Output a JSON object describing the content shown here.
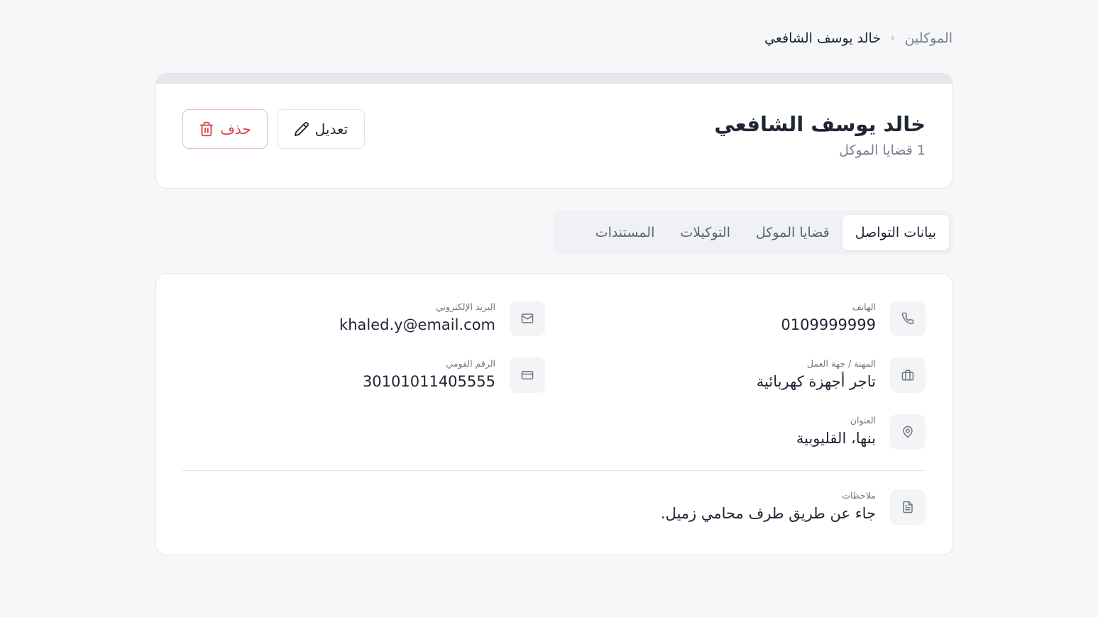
{
  "breadcrumb": {
    "parent": "الموكلين",
    "current": "خالد يوسف الشافعي"
  },
  "client": {
    "name": "خالد يوسف الشافعي",
    "subtitle": "1 قضايا الموكل"
  },
  "actions": {
    "edit_label": "تعديل",
    "delete_label": "حذف"
  },
  "tabs": [
    {
      "label": "بيانات التواصل",
      "active": true
    },
    {
      "label": "قضايا الموكل",
      "active": false
    },
    {
      "label": "التوكيلات",
      "active": false
    },
    {
      "label": "المستندات",
      "active": false
    }
  ],
  "details": {
    "phone": {
      "label": "الهاتف",
      "value": "0109999999",
      "icon": "phone-icon"
    },
    "email": {
      "label": "البريد الإلكتروني",
      "value": "khaled.y@email.com",
      "icon": "mail-icon"
    },
    "job": {
      "label": "المهنة / جهة العمل",
      "value": "تاجر أجهزة كهربائية",
      "icon": "briefcase-icon"
    },
    "national_id": {
      "label": "الرقم القومي",
      "value": "30101011405555",
      "icon": "id-card-icon"
    },
    "address": {
      "label": "العنوان",
      "value": "بنها، القليوبية",
      "icon": "map-pin-icon"
    },
    "notes": {
      "label": "ملاحظات",
      "value": "جاء عن طريق طرف محامي زميل.",
      "icon": "document-icon"
    }
  },
  "colors": {
    "background": "#f6f7f9",
    "danger": "#d9414a",
    "text": "#1e2533",
    "muted": "#7b8190"
  }
}
